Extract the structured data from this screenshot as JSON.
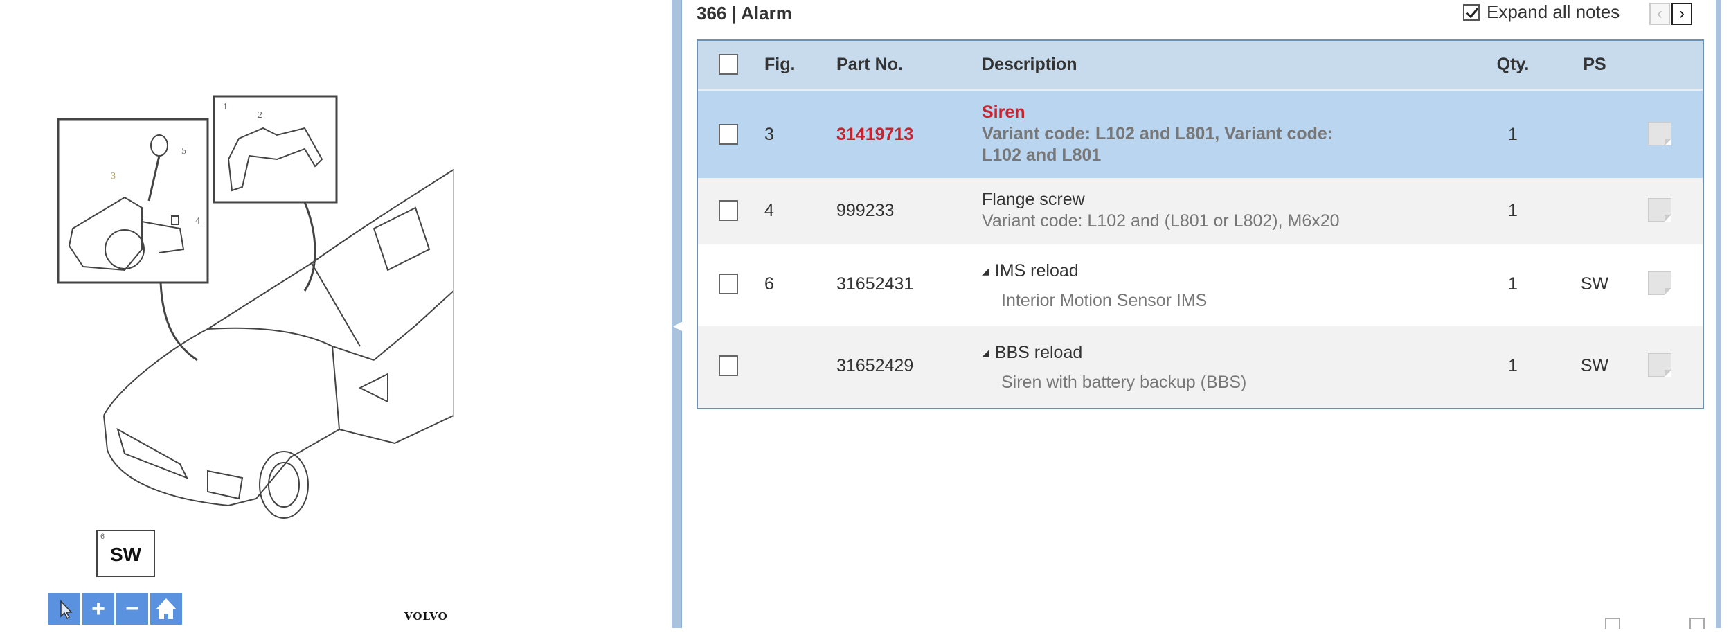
{
  "header": {
    "title": "366 | Alarm",
    "expand_all_notes_label": "Expand all notes",
    "expand_all_notes_checked": true,
    "prev_label": "‹",
    "next_label": "›"
  },
  "table": {
    "columns": {
      "fig": "Fig.",
      "part_no": "Part No.",
      "description": "Description",
      "qty": "Qty.",
      "ps": "PS"
    },
    "rows": [
      {
        "fig": "3",
        "part_no": "31419713",
        "title": "Siren",
        "note": "Variant code: L102 and L801, Variant code:",
        "note2": "L102 and L801",
        "qty": "1",
        "ps": "",
        "selected": true
      },
      {
        "fig": "4",
        "part_no": "999233",
        "title": "Flange screw",
        "note": "Variant code: L102 and (L801 or L802), M6x20",
        "qty": "1",
        "ps": ""
      },
      {
        "fig": "6",
        "part_no": "31652431",
        "title": "IMS reload",
        "note": "Interior Motion Sensor IMS",
        "qty": "1",
        "ps": "SW"
      },
      {
        "fig": "",
        "part_no": "31652429",
        "title": "BBS reload",
        "note": "Siren with battery backup (BBS)",
        "qty": "1",
        "ps": "SW"
      }
    ]
  },
  "illustration": {
    "callouts": [
      "1",
      "2",
      "3",
      "4",
      "5"
    ],
    "sw_box_number": "6",
    "sw_box_label": "SW",
    "logo": "VOLVO"
  },
  "toolbar": {
    "icons": [
      "pointer-icon",
      "zoom-in-icon",
      "zoom-out-icon",
      "home-icon"
    ],
    "zoom_in": "+",
    "zoom_out": "−"
  },
  "colors": {
    "accent": "#5b92e0",
    "selected_row": "#b9d5ef",
    "header": "#c8dbec",
    "part_red": "#c8232e"
  }
}
